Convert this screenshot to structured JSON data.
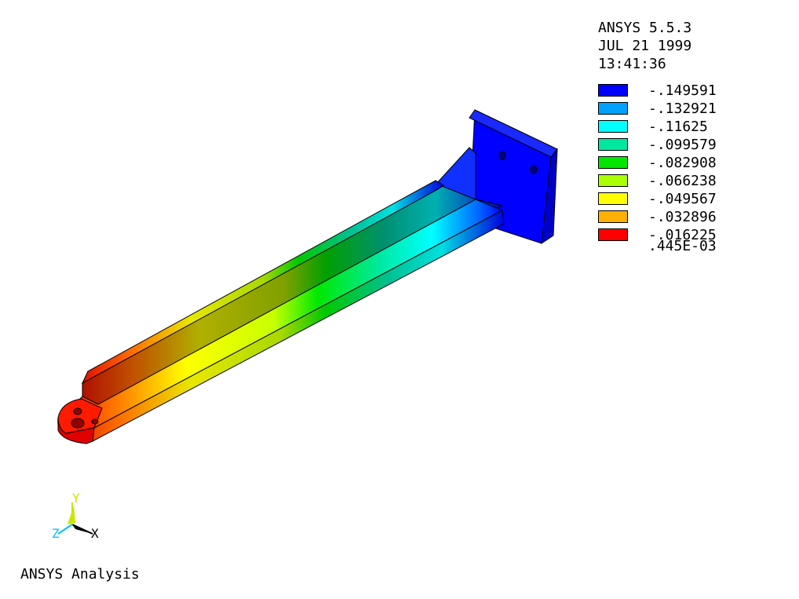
{
  "header": {
    "program": "ANSYS 5.5.3",
    "date": "JUL 21 1999",
    "time": "13:41:36"
  },
  "legend": {
    "entries": [
      {
        "value": "-.149591",
        "color": "#0000ff"
      },
      {
        "value": "-.132921",
        "color": "#00a0ff"
      },
      {
        "value": "-.11625",
        "color": "#00ffff"
      },
      {
        "value": "-.099579",
        "color": "#00e8a0"
      },
      {
        "value": "-.082908",
        "color": "#00e600"
      },
      {
        "value": "-.066238",
        "color": "#aaff00"
      },
      {
        "value": "-.049567",
        "color": "#ffff00"
      },
      {
        "value": "-.032896",
        "color": "#ffb000"
      },
      {
        "value": "-.016225",
        "color": "#ff0000"
      }
    ],
    "last_value": ".445E-03"
  },
  "triad": {
    "x_label": "X",
    "y_label": "Y",
    "z_label": "Z",
    "x_color": "#000000",
    "y_color": "#c8e600",
    "z_color": "#00c0ff"
  },
  "footer": {
    "title": "ANSYS Analysis"
  }
}
